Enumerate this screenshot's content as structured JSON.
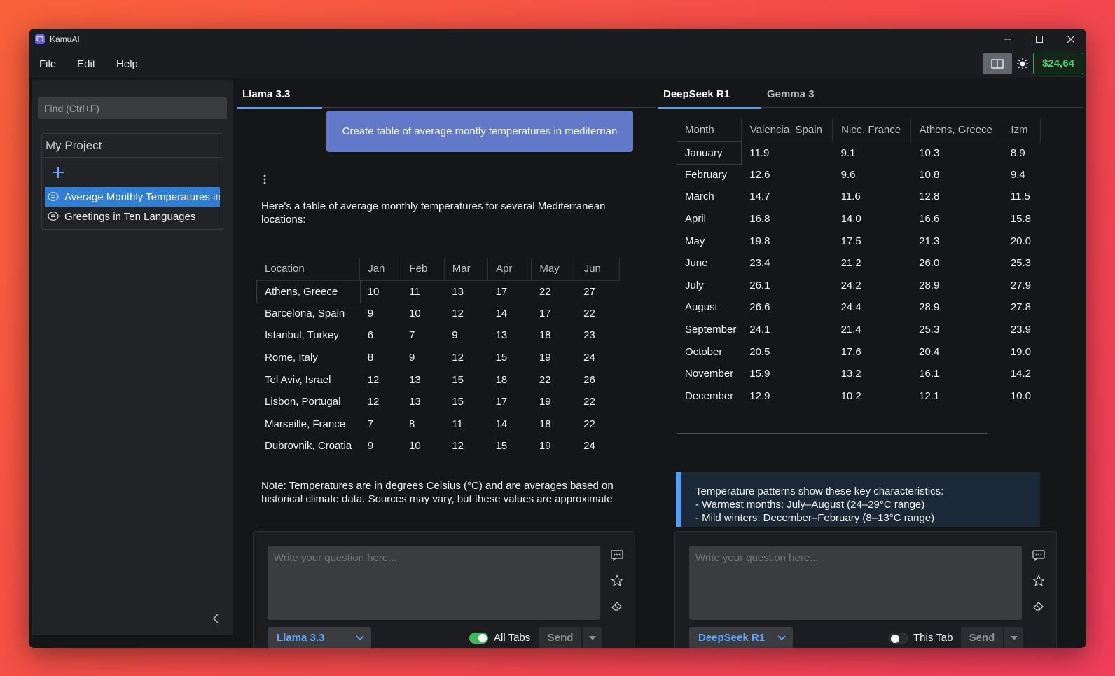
{
  "app": {
    "title": "KamuAI"
  },
  "menu": {
    "file": "File",
    "edit": "Edit",
    "help": "Help"
  },
  "balance": "$24,64",
  "sidebar": {
    "search_placeholder": "Find (Ctrl+F)",
    "project_title": "My Project",
    "chats": [
      {
        "label": "Average Monthly Temperatures in"
      },
      {
        "label": "Greetings in Ten Languages"
      }
    ]
  },
  "left_pane": {
    "tab": "Llama 3.3",
    "user_message": "Create table of average montly temperatures in mediterrian",
    "intro": "Here's a table of average monthly temperatures for several Mediterranean locations:",
    "table": {
      "headers": [
        "Location",
        "Jan",
        "Feb",
        "Mar",
        "Apr",
        "May",
        "Jun"
      ],
      "rows": [
        [
          "Athens, Greece",
          "10",
          "11",
          "13",
          "17",
          "22",
          "27"
        ],
        [
          "Barcelona, Spain",
          "9",
          "10",
          "12",
          "14",
          "17",
          "22"
        ],
        [
          "Istanbul, Turkey",
          "6",
          "7",
          "9",
          "13",
          "18",
          "23"
        ],
        [
          "Rome, Italy",
          "8",
          "9",
          "12",
          "15",
          "19",
          "24"
        ],
        [
          "Tel Aviv, Israel",
          "12",
          "13",
          "15",
          "18",
          "22",
          "26"
        ],
        [
          "Lisbon, Portugal",
          "12",
          "13",
          "15",
          "17",
          "19",
          "22"
        ],
        [
          "Marseille, France",
          "7",
          "8",
          "11",
          "14",
          "18",
          "22"
        ],
        [
          "Dubrovnik, Croatia",
          "9",
          "10",
          "12",
          "15",
          "19",
          "24"
        ]
      ]
    },
    "note": "Note: Temperatures are in degrees Celsius (°C) and are averages based on historical climate data. Sources may vary, but these values are approximate",
    "composer": {
      "placeholder": "Write your question here...",
      "model": "Llama 3.3",
      "toggle_label": "All Tabs",
      "send": "Send"
    }
  },
  "right_pane": {
    "tabs": [
      "DeepSeek R1",
      "Gemma 3"
    ],
    "table": {
      "headers": [
        "Month",
        "Valencia, Spain",
        "Nice, France",
        "Athens, Greece",
        "Izm"
      ],
      "rows": [
        [
          "January",
          "11.9",
          "9.1",
          "10.3",
          "8.9"
        ],
        [
          "February",
          "12.6",
          "9.6",
          "10.8",
          "9.4"
        ],
        [
          "March",
          "14.7",
          "11.6",
          "12.8",
          "11.5"
        ],
        [
          "April",
          "16.8",
          "14.0",
          "16.6",
          "15.8"
        ],
        [
          "May",
          "19.8",
          "17.5",
          "21.3",
          "20.0"
        ],
        [
          "June",
          "23.4",
          "21.2",
          "26.0",
          "25.3"
        ],
        [
          "July",
          "26.1",
          "24.2",
          "28.9",
          "27.9"
        ],
        [
          "August",
          "26.6",
          "24.4",
          "28.9",
          "27.8"
        ],
        [
          "September",
          "24.1",
          "21.4",
          "25.3",
          "23.9"
        ],
        [
          "October",
          "20.5",
          "17.6",
          "20.4",
          "19.0"
        ],
        [
          "November",
          "15.9",
          "13.2",
          "16.1",
          "14.2"
        ],
        [
          "December",
          "12.9",
          "10.2",
          "12.1",
          "10.0"
        ]
      ]
    },
    "quote_lines": [
      "Temperature patterns show these key characteristics:",
      "- Warmest months: July–August (24–29°C range)",
      "- Mild winters: December–February (8–13°C range)"
    ],
    "composer": {
      "placeholder": "Write your question here...",
      "model": "DeepSeek R1",
      "toggle_label": "This Tab",
      "send": "Send"
    }
  }
}
